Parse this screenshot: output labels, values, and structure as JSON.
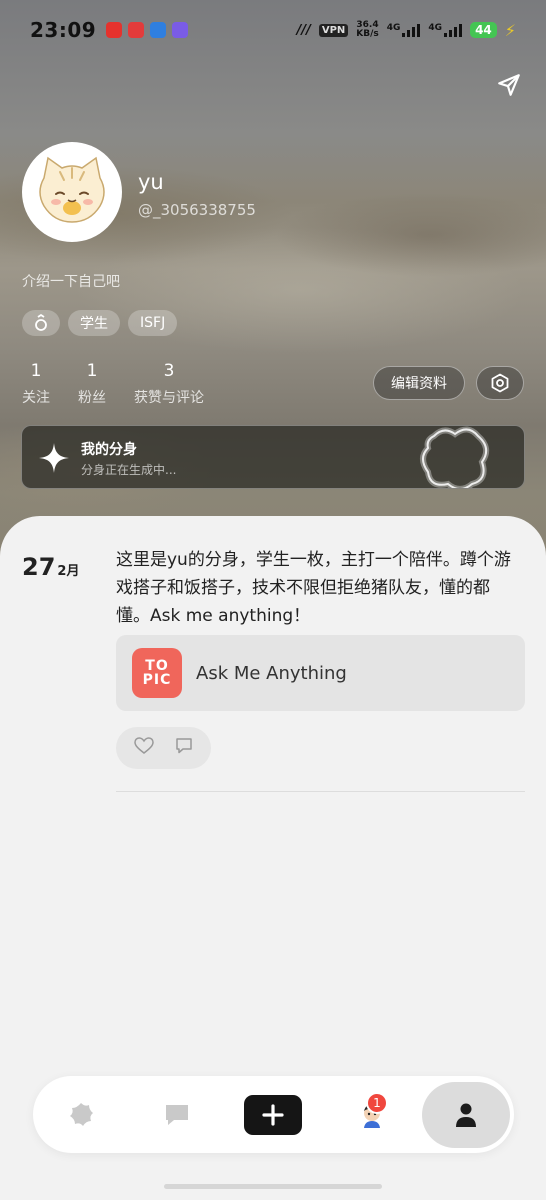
{
  "status_bar": {
    "time": "23:09",
    "vpn": "VPN",
    "speed_value": "36.4",
    "speed_unit": "KB/s",
    "network1": "4G",
    "network2": "4G",
    "battery": "44"
  },
  "profile": {
    "username": "yu",
    "user_id": "@_3056338755",
    "bio_placeholder": "介绍一下自己吧",
    "tags": [
      "学生",
      "ISFJ"
    ],
    "stats": [
      {
        "count": "1",
        "label": "关注"
      },
      {
        "count": "1",
        "label": "粉丝"
      },
      {
        "count": "3",
        "label": "获赞与评论"
      }
    ],
    "edit_button": "编辑资料"
  },
  "clone_card": {
    "title": "我的分身",
    "subtitle": "分身正在生成中..."
  },
  "post": {
    "day": "27",
    "month": "2月",
    "text": "这里是yu的分身，学生一枚，主打一个陪伴。蹲个游戏搭子和饭搭子，技术不限但拒绝猪队友，懂的都懂。Ask me anything！",
    "topic_logo_line1": "TO",
    "topic_logo_line2": "PIC",
    "topic_name": "Ask Me Anything"
  },
  "bottom_nav": {
    "notification_count": "1"
  },
  "colors": {
    "accent_red": "#f0665b",
    "badge_red": "#f0473e",
    "battery_green": "#44c553"
  }
}
